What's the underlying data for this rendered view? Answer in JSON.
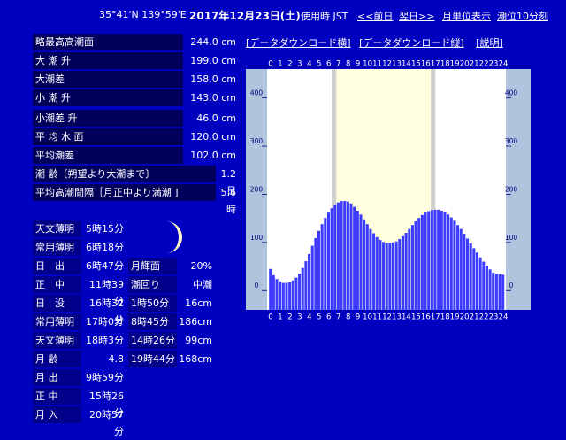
{
  "header": {
    "coords": "35°41'N 139°59'E",
    "date": "2017年12月23日(土)",
    "timezone": "使用時 JST",
    "prev_link": "<<前日",
    "next_link": "翌日>>",
    "month_link": "月単位表示",
    "interval_link": "潮位10分刻"
  },
  "stats": [
    {
      "label": "略最高高潮面",
      "value": "244.0 cm"
    },
    {
      "label": "大 潮 升",
      "value": "199.0 cm"
    },
    {
      "label": "大潮差",
      "value": "158.0 cm"
    },
    {
      "label": "小 潮 升",
      "value": "143.0 cm"
    },
    {
      "label": "小潮差 升",
      "value": "46.0 cm"
    },
    {
      "label": "平 均 水 面",
      "value": "120.0 cm"
    },
    {
      "label": "平均潮差",
      "value": "102.0 cm"
    }
  ],
  "stats_wide": [
    {
      "label": "潮 齢〔朔望より大潮まで〕",
      "value": "1.2 日"
    },
    {
      "label": "平均高潮間隔［月正中より満潮 ]",
      "value": "5.6 時"
    }
  ],
  "astro": [
    {
      "label": "天文薄明",
      "value": "5時15分"
    },
    {
      "label": "常用薄明",
      "value": "6時18分"
    },
    {
      "label": "日　出",
      "value": "6時47分"
    },
    {
      "label": "正　中",
      "value": "11時39分"
    },
    {
      "label": "日　没",
      "value": "16時32分"
    },
    {
      "label": "常用薄明",
      "value": "17時0分"
    },
    {
      "label": "天文薄明",
      "value": "18時3分"
    },
    {
      "label": "月 齢",
      "value": "4.8"
    },
    {
      "label": "月 出",
      "value": "9時59分"
    },
    {
      "label": "正 中",
      "value": "15時26分"
    },
    {
      "label": "月 入",
      "value": "20時57分"
    }
  ],
  "moon": {
    "illum_label": "月輝面",
    "illum_value": "20%",
    "tide_label": "潮回り",
    "tide_value": "中潮"
  },
  "tide_events": [
    {
      "time": "1時50分",
      "height": "16cm"
    },
    {
      "time": "8時45分",
      "height": "186cm"
    },
    {
      "time": "14時26分",
      "height": "99cm"
    },
    {
      "time": "19時44分",
      "height": "168cm"
    }
  ],
  "chart_links": {
    "download_h": "[データダウンロード横]",
    "download_v": "[データダウンロード縦]",
    "help": "[説明]"
  },
  "colors": {
    "background": "#0000c0",
    "label_bg": "#00005a",
    "bar": "#3c3cff",
    "day": "#ffffe0",
    "twilight": "#d0d0d0",
    "scale_bg": "#b0c4de"
  },
  "chart_data": {
    "type": "bar",
    "x_ticks": [
      "0",
      "1",
      "2",
      "3",
      "4",
      "5",
      "6",
      "7",
      "8",
      "9",
      "10",
      "11",
      "12",
      "13",
      "14",
      "15",
      "16",
      "17",
      "18",
      "19",
      "20",
      "21",
      "22",
      "23",
      "24"
    ],
    "y_ticks": [
      "0",
      "100",
      "200",
      "300",
      "400"
    ],
    "ylim": [
      -40,
      460
    ],
    "xlim": [
      0,
      24
    ],
    "day_period": [
      6.78,
      16.53
    ],
    "twilight_period": [
      6.3,
      17.0
    ],
    "series": [
      {
        "x": [
          0,
          0.333,
          0.667,
          1,
          1.333,
          1.667,
          2,
          2.333,
          2.667,
          3,
          3.333,
          3.667,
          4,
          4.333,
          4.667,
          5,
          5.333,
          5.667,
          6,
          6.333,
          6.667,
          7,
          7.333,
          7.667,
          8,
          8.333,
          8.667,
          9,
          9.333,
          9.667,
          10,
          10.333,
          10.667,
          11,
          11.333,
          11.667,
          12,
          12.333,
          12.667,
          13,
          13.333,
          13.667,
          14,
          14.333,
          14.667,
          15,
          15.333,
          15.667,
          16,
          16.333,
          16.667,
          17,
          17.333,
          17.667,
          18,
          18.333,
          18.667,
          19,
          19.333,
          19.667,
          20,
          20.333,
          20.667,
          21,
          21.333,
          21.667,
          22,
          22.333,
          22.667,
          23,
          23.333,
          23.667,
          24
        ],
        "values": [
          45,
          32,
          24,
          19,
          16,
          16,
          17,
          21,
          27,
          35,
          47,
          61,
          76,
          93,
          109,
          124,
          138,
          151,
          162,
          171,
          178,
          183,
          186,
          186,
          185,
          181,
          174,
          166,
          158,
          148,
          138,
          128,
          119,
          111,
          105,
          101,
          99,
          99,
          100,
          102,
          107,
          113,
          120,
          128,
          136,
          144,
          151,
          157,
          162,
          165,
          167,
          168,
          168,
          166,
          163,
          158,
          152,
          145,
          136,
          128,
          118,
          108,
          98,
          88,
          79,
          69,
          60,
          52,
          44,
          37,
          35,
          34,
          33
        ]
      }
    ]
  }
}
